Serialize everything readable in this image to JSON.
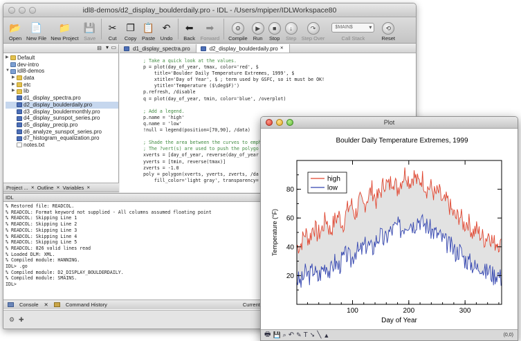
{
  "main_window": {
    "title": "idl8-demos/d2_display_boulderdaily.pro - IDL - /Users/mpiper/IDLWorkspace80",
    "toolbar": [
      {
        "label": "Open",
        "icon": "folder-open-icon",
        "glyph": "📂",
        "enabled": true
      },
      {
        "label": "New File",
        "icon": "new-file-icon",
        "glyph": "📄",
        "enabled": true
      },
      {
        "label": "New Project",
        "icon": "new-project-icon",
        "glyph": "📁",
        "enabled": true
      },
      {
        "label": "Save",
        "icon": "save-icon",
        "glyph": "💾",
        "enabled": false
      },
      {
        "label": "Cut",
        "icon": "scissors-icon",
        "glyph": "✂",
        "enabled": true
      },
      {
        "label": "Copy",
        "icon": "copy-icon",
        "glyph": "❐",
        "enabled": true
      },
      {
        "label": "Paste",
        "icon": "paste-icon",
        "glyph": "📋",
        "enabled": true
      },
      {
        "label": "Undo",
        "icon": "undo-icon",
        "glyph": "↶",
        "enabled": true
      },
      {
        "label": "Back",
        "icon": "back-arrow-icon",
        "glyph": "⬅",
        "enabled": true
      },
      {
        "label": "Forward",
        "icon": "forward-arrow-icon",
        "glyph": "➡",
        "enabled": false
      }
    ],
    "run_controls": [
      {
        "label": "Compile",
        "icon": "compile-icon",
        "glyph": "⚙",
        "enabled": true
      },
      {
        "label": "Run",
        "icon": "run-icon",
        "glyph": "▶",
        "enabled": true
      },
      {
        "label": "Stop",
        "icon": "stop-icon",
        "glyph": "■",
        "enabled": true
      },
      {
        "label": "Step",
        "icon": "step-icon",
        "glyph": "↓",
        "enabled": false
      },
      {
        "label": "Step Over",
        "icon": "step-over-icon",
        "glyph": "↷",
        "enabled": false
      }
    ],
    "call_stack": {
      "label": "Call Stack",
      "value": "$MAIN$"
    },
    "reset_label": "Reset",
    "project_tree": [
      {
        "label": "Default",
        "type": "folder",
        "indent": 0,
        "twisty": "▶"
      },
      {
        "label": "dev-intro",
        "type": "proj",
        "indent": 0,
        "twisty": ""
      },
      {
        "label": "idl8-demos",
        "type": "proj",
        "indent": 0,
        "twisty": "▼"
      },
      {
        "label": "data",
        "type": "folder",
        "indent": 1,
        "twisty": "▶"
      },
      {
        "label": "etc",
        "type": "folder",
        "indent": 1,
        "twisty": "▶"
      },
      {
        "label": "lib",
        "type": "folder",
        "indent": 1,
        "twisty": "▶"
      },
      {
        "label": "d1_display_spectra.pro",
        "type": "file",
        "indent": 1,
        "twisty": ""
      },
      {
        "label": "d2_display_boulderdaily.pro",
        "type": "file",
        "indent": 1,
        "twisty": "",
        "selected": true
      },
      {
        "label": "d3_display_bouldermonthly.pro",
        "type": "file",
        "indent": 1,
        "twisty": ""
      },
      {
        "label": "d4_display_sunspot_series.pro",
        "type": "file",
        "indent": 1,
        "twisty": ""
      },
      {
        "label": "d5_display_precip.pro",
        "type": "file",
        "indent": 1,
        "twisty": ""
      },
      {
        "label": "d6_analyze_sunspot_series.pro",
        "type": "file",
        "indent": 1,
        "twisty": ""
      },
      {
        "label": "d7_histogram_equalization.pro",
        "type": "file",
        "indent": 1,
        "twisty": ""
      },
      {
        "label": "notes.txt",
        "type": "txt",
        "indent": 1,
        "twisty": ""
      }
    ],
    "left_tabs": [
      "Project ...",
      "Outline",
      "Variables"
    ],
    "editor_tabs": [
      {
        "label": "d1_display_spectra.pro",
        "active": false
      },
      {
        "label": "d2_display_boulderdaily.pro",
        "active": true
      }
    ],
    "code_lines": [
      {
        "cls": "cm",
        "text": "; Take a quick look at the values."
      },
      {
        "cls": "",
        "text": "p = plot(day_of_year, tmax, color='red', $"
      },
      {
        "cls": "",
        "text": "    title='Boulder Daily Temperature Extremes, 1999', $"
      },
      {
        "cls": "",
        "text": "    xtitle='Day of Year', $ ; term used by GSFC, so it must be OK!"
      },
      {
        "cls": "",
        "text": "    ytitle='Temperature ($\\deg$F)')"
      },
      {
        "cls": "",
        "text": "p.refresh, /disable"
      },
      {
        "cls": "",
        "text": "q = plot(day_of_year, tmin, color='blue', /overplot)"
      },
      {
        "cls": "",
        "text": ""
      },
      {
        "cls": "cm",
        "text": "; Add a legend."
      },
      {
        "cls": "",
        "text": "p.name = 'high'"
      },
      {
        "cls": "",
        "text": "q.name = 'low'"
      },
      {
        "cls": "",
        "text": "!null = legend(position=[70,90], /data)"
      },
      {
        "cls": "",
        "text": ""
      },
      {
        "cls": "cm",
        "text": "; Shade the area between the curves to emph"
      },
      {
        "cls": "cm",
        "text": "; The ?vert(s) are used to push the polygo"
      },
      {
        "cls": "",
        "text": "xverts = [day_of_year, reverse(day_of_year"
      },
      {
        "cls": "",
        "text": "yverts = [tmin, reverse(tmax)]"
      },
      {
        "cls": "",
        "text": "zverts = -1.0"
      },
      {
        "cls": "",
        "text": "poly = polygon(xverts, yverts, zverts, /da"
      },
      {
        "cls": "",
        "text": "    fill_color='light gray', transparency="
      }
    ],
    "console_title": "IDL",
    "console_lines": [
      "% Restored file: READCOL.",
      "% READCOL: Format keyword not supplied - All columns assumed floating point",
      "% READCOL: Skipping Line 1",
      "% READCOL: Skipping Line 2",
      "% READCOL: Skipping Line 3",
      "% READCOL: Skipping Line 4",
      "% READCOL: Skipping Line 5",
      "% READCOL: 826 valid lines read",
      "% Loaded DLM: XML.",
      "% Compiled module: HANNING.",
      "IDL> .go",
      "% Compiled module: D2_DISPLAY_BOULDERDAILY.",
      "% Compiled module: SMAINS.",
      "IDL>"
    ],
    "console_tabs": [
      "Console",
      "Command History"
    ],
    "current_directory_label": "Current Directo"
  },
  "plot_window": {
    "title": "Plot",
    "coord_readout": "(0,0)",
    "toolbar_icons": [
      "print-icon",
      "save-icon",
      "zoom-icon",
      "undo-icon",
      "pencil-icon",
      "text-tool-icon",
      "arrow-tool-icon",
      "line-tool-icon",
      "shape-tool-icon"
    ]
  },
  "chart_data": {
    "type": "line",
    "title": "Boulder Daily Temperature Extremes, 1999",
    "xlabel": "Day of Year",
    "ylabel": "Temperature (°F)",
    "xlim": [
      1,
      365
    ],
    "ylim": [
      0,
      100
    ],
    "xticks": [
      100,
      200,
      300
    ],
    "yticks": [
      20,
      40,
      60,
      80
    ],
    "legend": {
      "placement": "top-left",
      "entries": [
        "high",
        "low"
      ]
    },
    "shading": "light gray between curves",
    "series": [
      {
        "name": "high",
        "color": "#e0452f",
        "values_profile": [
          40,
          42,
          50,
          45,
          55,
          48,
          52,
          60,
          50,
          58,
          62,
          55,
          65,
          70,
          62,
          72,
          68,
          75,
          80,
          72,
          78,
          85,
          82,
          88,
          80,
          86,
          92,
          85,
          90,
          84,
          88,
          80,
          82,
          76,
          78,
          70,
          72,
          65,
          60,
          62,
          55,
          58,
          50,
          52,
          48,
          45,
          50,
          42,
          44,
          40
        ]
      },
      {
        "name": "low",
        "color": "#3345b0",
        "values_profile": [
          18,
          15,
          22,
          20,
          25,
          18,
          24,
          28,
          22,
          30,
          26,
          32,
          35,
          30,
          38,
          36,
          40,
          42,
          38,
          45,
          48,
          44,
          50,
          52,
          55,
          52,
          56,
          58,
          55,
          60,
          57,
          55,
          52,
          50,
          48,
          45,
          42,
          40,
          36,
          38,
          32,
          30,
          28,
          25,
          28,
          22,
          24,
          20,
          22,
          18
        ]
      }
    ]
  }
}
